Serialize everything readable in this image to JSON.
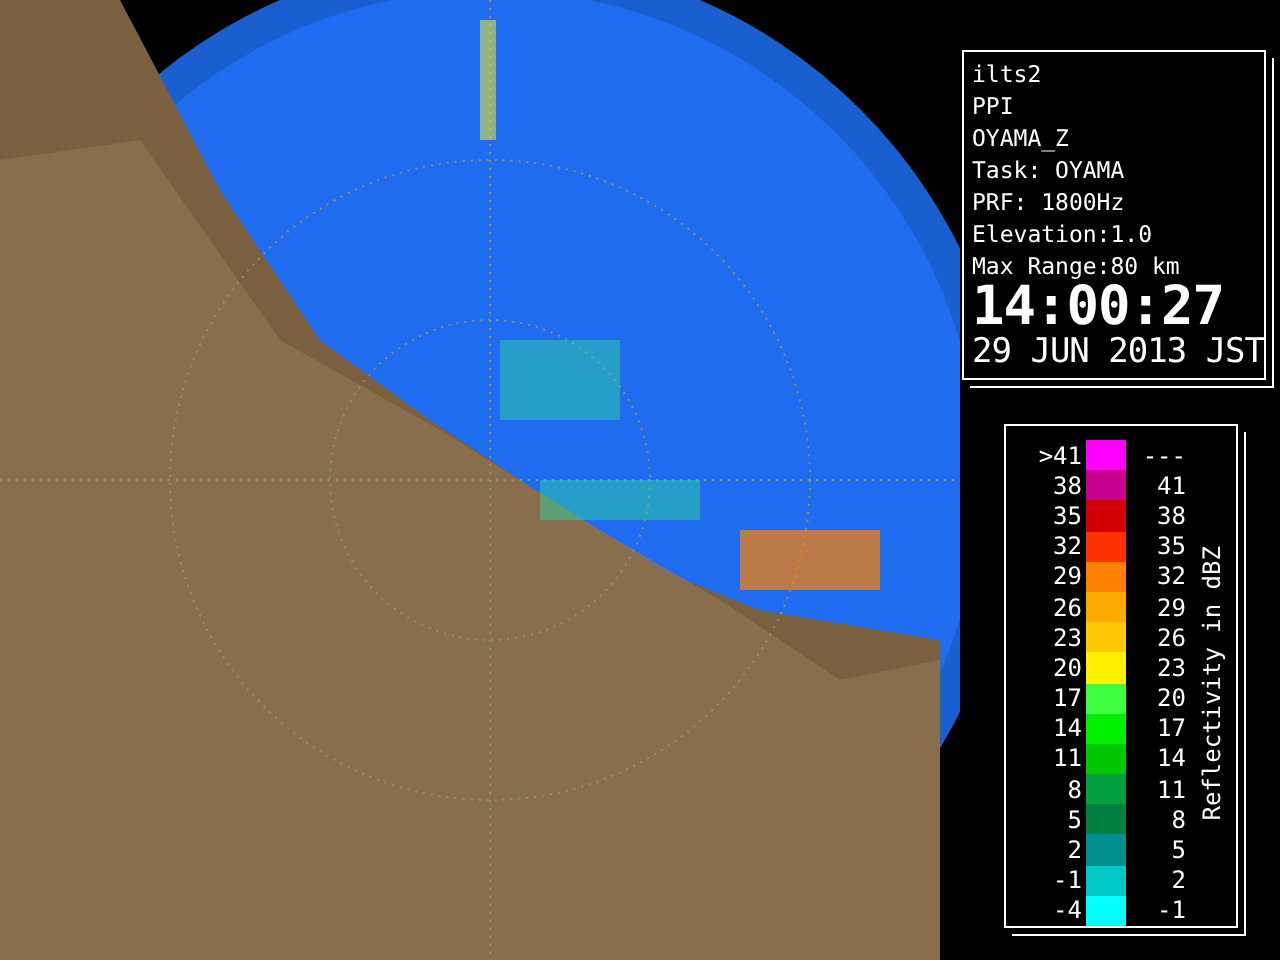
{
  "info": {
    "lines": [
      "ilts2",
      "PPI",
      "OYAMA_Z",
      "Task: OYAMA",
      "PRF: 1800Hz",
      "Elevation:1.0",
      "Max Range:80 km"
    ],
    "time": "14:00:27",
    "date": "29 JUN 2013 JST"
  },
  "legend": {
    "title": "Reflectivity in dBZ",
    "rows": [
      {
        "low": ">41",
        "high": "---",
        "color": "#ff00ff"
      },
      {
        "low": "38",
        "high": "41",
        "color": "#c80090"
      },
      {
        "low": "35",
        "high": "38",
        "color": "#d00000"
      },
      {
        "low": "32",
        "high": "35",
        "color": "#ff3000"
      },
      {
        "low": "29",
        "high": "32",
        "color": "#ff8000"
      },
      {
        "low": "26",
        "high": "29",
        "color": "#ffa800"
      },
      {
        "low": "23",
        "high": "26",
        "color": "#ffc800"
      },
      {
        "low": "20",
        "high": "23",
        "color": "#fff000"
      },
      {
        "low": "17",
        "high": "20",
        "color": "#40ff40"
      },
      {
        "low": "14",
        "high": "17",
        "color": "#00f000"
      },
      {
        "low": "11",
        "high": "14",
        "color": "#00c800"
      },
      {
        "low": "8",
        "high": "11",
        "color": "#00a040"
      },
      {
        "low": "5",
        "high": "8",
        "color": "#008040"
      },
      {
        "low": "2",
        "high": "5",
        "color": "#009090"
      },
      {
        "low": "-1",
        "high": "2",
        "color": "#00c8c8"
      },
      {
        "low": "-4",
        "high": "-1",
        "color": "#00ffff"
      }
    ]
  }
}
